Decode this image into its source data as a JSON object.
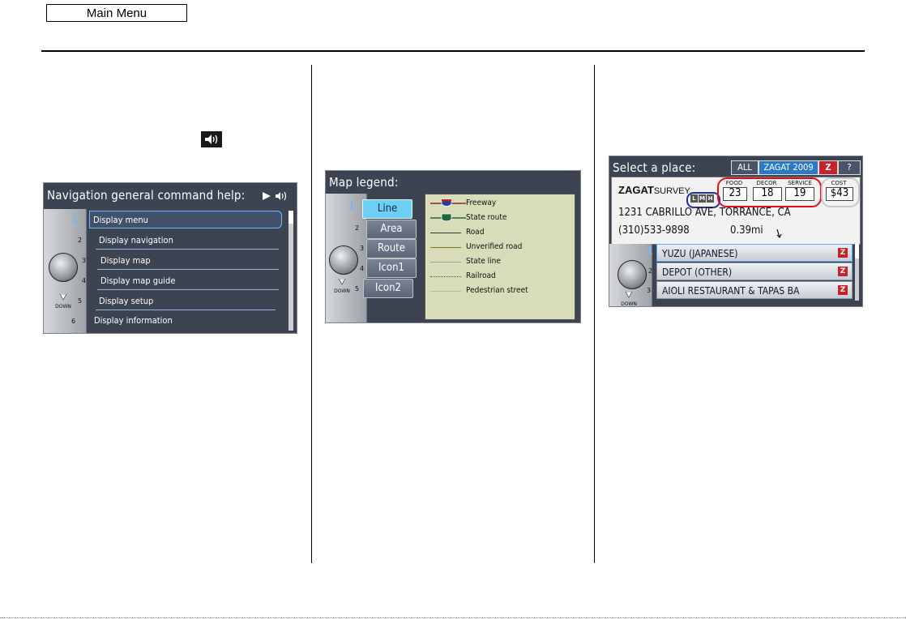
{
  "header": {
    "main_menu_label": "Main Menu"
  },
  "panel1": {
    "title": "Navigation general command help:",
    "items": [
      {
        "num": "1",
        "label": "Display menu"
      },
      {
        "num": "2",
        "label": "Display navigation"
      },
      {
        "num": "3",
        "label": "Display map"
      },
      {
        "num": "4",
        "label": "Display map guide"
      },
      {
        "num": "5",
        "label": "Display setup"
      },
      {
        "num": "6",
        "label": "Display information"
      }
    ],
    "down_label": "DOWN"
  },
  "panel2": {
    "title": "Map legend:",
    "tabs": [
      {
        "num": "1",
        "label": "Line"
      },
      {
        "num": "2",
        "label": "Area"
      },
      {
        "num": "3",
        "label": "Route"
      },
      {
        "num": "4",
        "label": "Icon1"
      },
      {
        "num": "5",
        "label": "Icon2"
      }
    ],
    "legend": [
      {
        "label": "Freeway",
        "shield": "110"
      },
      {
        "label": "State route",
        "shield": "91"
      },
      {
        "label": "Road"
      },
      {
        "label": "Unverified road"
      },
      {
        "label": "State line"
      },
      {
        "label": "Railroad"
      },
      {
        "label": "Pedestrian street"
      }
    ],
    "down_label": "DOWN"
  },
  "panel3": {
    "title": "Select a place:",
    "tab_all": "ALL",
    "tab_zagat": "ZAGAT 2009",
    "tab_z": "Z",
    "tab_help": "?",
    "brand": "ZAGAT",
    "brand_suffix": "SURVEY",
    "lmh": [
      "L",
      "M",
      "H"
    ],
    "scores": [
      {
        "head": "FOOD",
        "value": "23"
      },
      {
        "head": "DECOR",
        "value": "18"
      },
      {
        "head": "SERVICE",
        "value": "19"
      }
    ],
    "cost_head": "COST",
    "cost_value": "$43",
    "address": "1231 CABRILLO AVE, TORRANCE, CA",
    "phone": "(310)533-9898",
    "distance": "0.39mi",
    "results": [
      {
        "num": "1",
        "label": "YUZU (JAPANESE)"
      },
      {
        "num": "2",
        "label": "DEPOT (OTHER)"
      },
      {
        "num": "3",
        "label": "AIOLI RESTAURANT & TAPAS BA"
      }
    ],
    "down_label": "DOWN"
  },
  "colors": {
    "screen_bg": "#3c4452",
    "highlight": "#6fb6ff",
    "legend_bg": "#d8dcb8",
    "zagat_red": "#c8222a",
    "circle_red": "#e0101a",
    "circle_blue": "#2030a0"
  }
}
